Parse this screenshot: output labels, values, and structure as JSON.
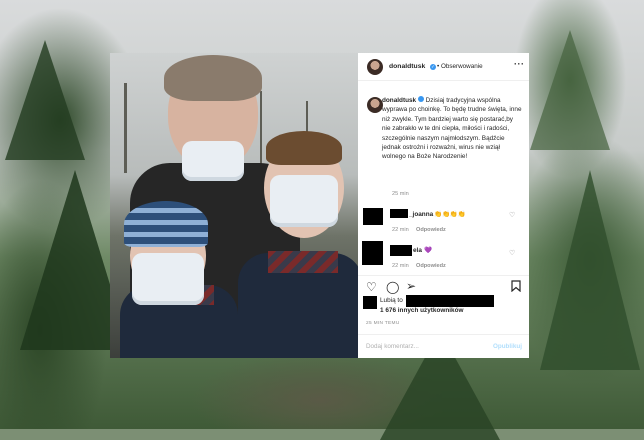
{
  "post": {
    "author": "donaldtusk",
    "follow_label": "Obserwowanie",
    "more_icon": "more-horizontal-icon",
    "verified_icon": "verified-badge-icon",
    "caption": "Dzisiaj tradycyjna wspólna wyprawa po choinkę. To będę trudne święta, inne niż zwykle. Tym bardziej warto się postarać,by nie zabrakło w te dni ciepła, miłości i radości, szczególnie naszym najmłodszym. Bądźcie jednak ostrożni i rozważni, wirus nie wziął wolnego na Boże Narodzenie!",
    "caption_time": "25 min",
    "comments": [
      {
        "user_suffix": "_joanna",
        "text": "👏👏👏👏",
        "time": "22 min",
        "reply_label": "Odpowiedz"
      },
      {
        "user_suffix": "ela",
        "text": "💜",
        "time": "22 min",
        "reply_label": "Odpowiedz"
      }
    ],
    "actions": {
      "like_icon": "heart-icon",
      "comment_icon": "comment-icon",
      "share_icon": "share-icon",
      "save_icon": "bookmark-icon"
    },
    "likes_prefix": "Lubią to",
    "likes_others": "1 676 innych użytkowników",
    "posted_ago": "25 MIN TEMU",
    "comment_placeholder": "Dodaj komentarz...",
    "publish_label": "Opublikuj"
  },
  "colors": {
    "verified": "#3897f0",
    "meta_gray": "#8e8e8e",
    "publish_disabled": "#b2dffc",
    "redaction": "#000000"
  }
}
